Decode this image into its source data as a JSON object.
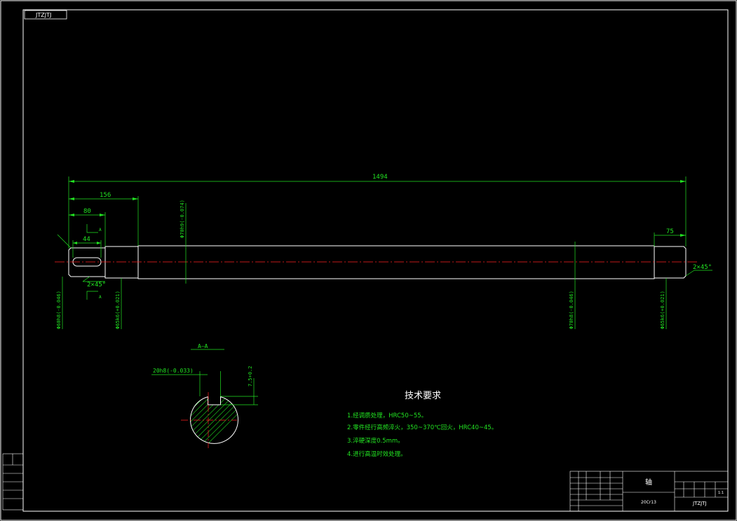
{
  "drawing": {
    "corner_code": "JTZJTJ",
    "dimensions": {
      "overall_length": "1494",
      "left_section": "156",
      "keyway_position": "80",
      "keyway_width": "44",
      "right_section": "75",
      "left_chamfer": "2×45°",
      "right_chamfer": "2×45°",
      "dia_left_end": "Φ60h8(-0.046)",
      "dia_left_bearing": "Φ65k6(+0.021)",
      "dia_main_top": "Φ70h9(-0.074)",
      "dia_main_right": "Φ70h8(-0.046)",
      "dia_right_bearing": "Φ65k6(+0.021)"
    },
    "section": {
      "label": "A—A",
      "key_width": "20h8(-0.033)",
      "depth": "7.5+0.2"
    },
    "requirements": {
      "title": "技术要求",
      "items": [
        "1.经调质处理，HRC50~55。",
        "2.零件经行高频淬火，350~370℃回火，HRC40~45。",
        "3.淬硬深度0.5mm。",
        "4.进行高温时效处理。"
      ]
    },
    "title_block": {
      "part_name": "轴",
      "material": "20Cr13",
      "scale": "1:1",
      "code": "JTZJTJ"
    }
  }
}
